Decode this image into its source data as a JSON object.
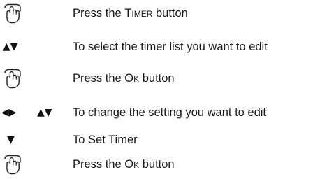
{
  "steps": [
    {
      "icon": "hand-press-icon",
      "text_before": "Press the ",
      "text_key": "Timer",
      "text_after": " button"
    },
    {
      "icon": "up-down-arrows-icon",
      "text": "To select the timer list you want to edit"
    },
    {
      "icon": "hand-press-icon",
      "text_before": "Press the ",
      "text_key": "Ok",
      "text_after": " button"
    },
    {
      "icon": "left-right-up-down-arrows-icon",
      "text": "To change the setting you want to edit"
    },
    {
      "icon": "down-arrow-icon",
      "text": "To Set Timer"
    },
    {
      "icon": "hand-press-icon",
      "text_before": "Press the ",
      "text_key": "Ok",
      "text_after": " button"
    }
  ],
  "glyphs": {
    "left_right": "◀▶",
    "up_down": "▲▼",
    "down": "▼"
  }
}
